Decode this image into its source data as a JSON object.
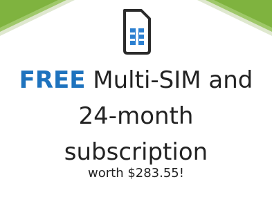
{
  "promo": {
    "free_label": "FREE",
    "line1_rest": " Multi-SIM and",
    "line2": "24-month",
    "line3": "subscription",
    "note": "worth $283.55!"
  },
  "icons": {
    "sim": "sim-card-icon"
  },
  "colors": {
    "free_text": "#1e73be",
    "body_text": "#222222",
    "sim_outline": "#2b2b2b",
    "sim_chip": "#2b7fd0",
    "corner_green": "#7fb33f",
    "corner_light": "#dfe8cf"
  }
}
